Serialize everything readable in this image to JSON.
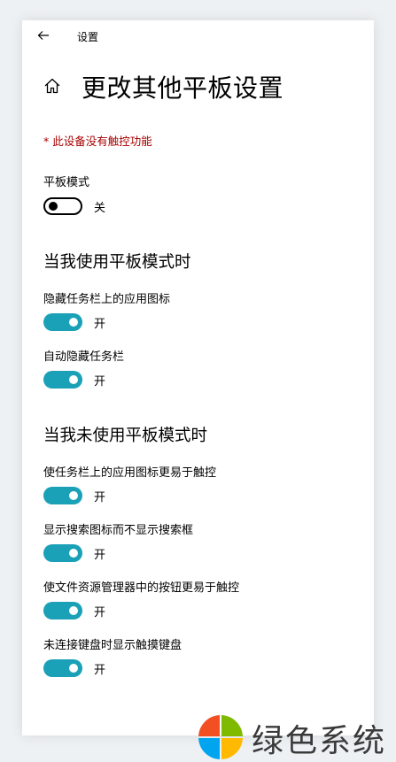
{
  "window": {
    "title": "设置",
    "back_icon": "arrow-left-icon"
  },
  "header": {
    "home_icon": "home-icon",
    "title": "更改其他平板设置"
  },
  "warning": "* 此设备没有触控功能",
  "tablet_mode": {
    "label": "平板模式",
    "state": "关",
    "on": false
  },
  "section_using": {
    "title": "当我使用平板模式时",
    "items": [
      {
        "label": "隐藏任务栏上的应用图标",
        "state": "开",
        "on": true
      },
      {
        "label": "自动隐藏任务栏",
        "state": "开",
        "on": true
      }
    ]
  },
  "section_not_using": {
    "title": "当我未使用平板模式时",
    "items": [
      {
        "label": "使任务栏上的应用图标更易于触控",
        "state": "开",
        "on": true
      },
      {
        "label": "显示搜索图标而不显示搜索框",
        "state": "开",
        "on": true
      },
      {
        "label": "使文件资源管理器中的按钮更易于触控",
        "state": "开",
        "on": true
      },
      {
        "label": "未连接键盘时显示触摸键盘",
        "state": "开",
        "on": true
      }
    ]
  },
  "colors": {
    "accent": "#1ba1b7",
    "warning": "#a80000"
  },
  "watermark": {
    "text": "绿色系统"
  }
}
